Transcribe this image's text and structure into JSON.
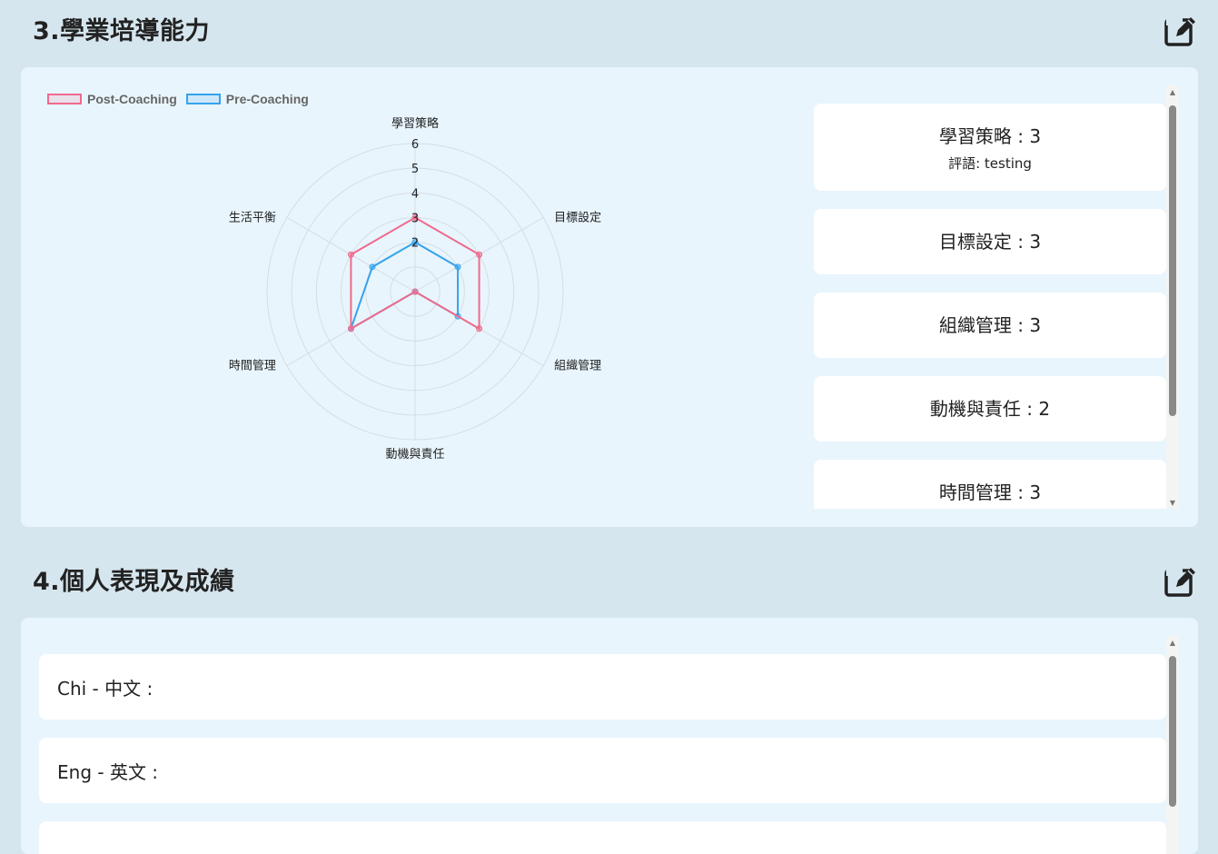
{
  "section3": {
    "title": "3.學業培導能力",
    "edit_icon": "edit-icon",
    "legend": [
      {
        "label": "Post-Coaching",
        "color": "#f06a8c"
      },
      {
        "label": "Pre-Coaching",
        "color": "#36a2eb"
      }
    ],
    "cards": [
      {
        "title": "學習策略 : 3",
        "comment": "評語: testing"
      },
      {
        "title": "目標設定 : 3",
        "comment": ""
      },
      {
        "title": "組織管理 : 3",
        "comment": ""
      },
      {
        "title": "動機與責任 : 2",
        "comment": ""
      },
      {
        "title": "時間管理 : 3",
        "comment": ""
      }
    ]
  },
  "section4": {
    "title": "4.個人表現及成績",
    "edit_icon": "edit-icon",
    "subjects": [
      {
        "label": "Chi - 中文 :"
      },
      {
        "label": "Eng - 英文 :"
      },
      {
        "label": ""
      }
    ]
  },
  "chart_data": {
    "type": "radar",
    "categories": [
      "學習策略",
      "目標設定",
      "組織管理",
      "動機與責任",
      "時間管理",
      "生活平衡"
    ],
    "series": [
      {
        "name": "Post-Coaching",
        "color": "#f06a8c",
        "values": [
          3,
          3,
          3,
          0,
          3,
          3
        ]
      },
      {
        "name": "Pre-Coaching",
        "color": "#36a2eb",
        "values": [
          2,
          2,
          2,
          0,
          3,
          2
        ]
      }
    ],
    "rlim": [
      0,
      6
    ],
    "ticks": [
      2,
      3,
      4,
      5,
      6
    ],
    "legend": "top-left",
    "grid": true
  }
}
